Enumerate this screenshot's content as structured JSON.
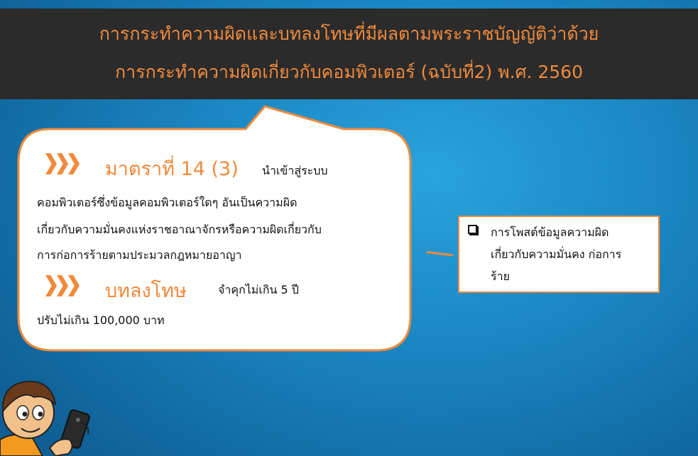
{
  "header": {
    "line1": "การกระทำความผิดและบทลงโทษที่มีผลตามพระราชบัญญัติว่าด้วย",
    "line2": "การกระทำความผิดเกี่ยวกับคอมพิวเตอร์ (ฉบับที่2) พ.ศ. 2560"
  },
  "bubble": {
    "section_title": "มาตราที่ 14 (3)",
    "section_intro": "นำเข้าสู่ระบบ",
    "body_lines": [
      "คอมพิวเตอร์ซึ่งข้อมูลคอมพิวเตอร์ใดๆ อันเป็นความผิด",
      "เกี่ยวกับความมั่นคงแห่งราชอาณาจักรหรือความผิดเกี่ยวกับ",
      "การก่อการร้ายตามประมวลกฎหมายอาญา"
    ],
    "penalty_title": "บทลงโทษ",
    "penalty_intro": "จำคุกไม่เกิน 5 ปี",
    "penalty_line": "ปรับไม่เกิน 100,000 บาท"
  },
  "note": {
    "lines": [
      "การโพสต์ข้อมูลความผิด",
      "เกี่ยวกับความมั่นคง ก่อการ",
      "ร้าย"
    ]
  },
  "colors": {
    "accent": "#f08a3c",
    "header_bg": "#2b2b2b",
    "background": "#1a86c2"
  },
  "icons": [
    "chevron-triple-icon",
    "checkbox-icon",
    "mascot-with-phone-icon"
  ]
}
